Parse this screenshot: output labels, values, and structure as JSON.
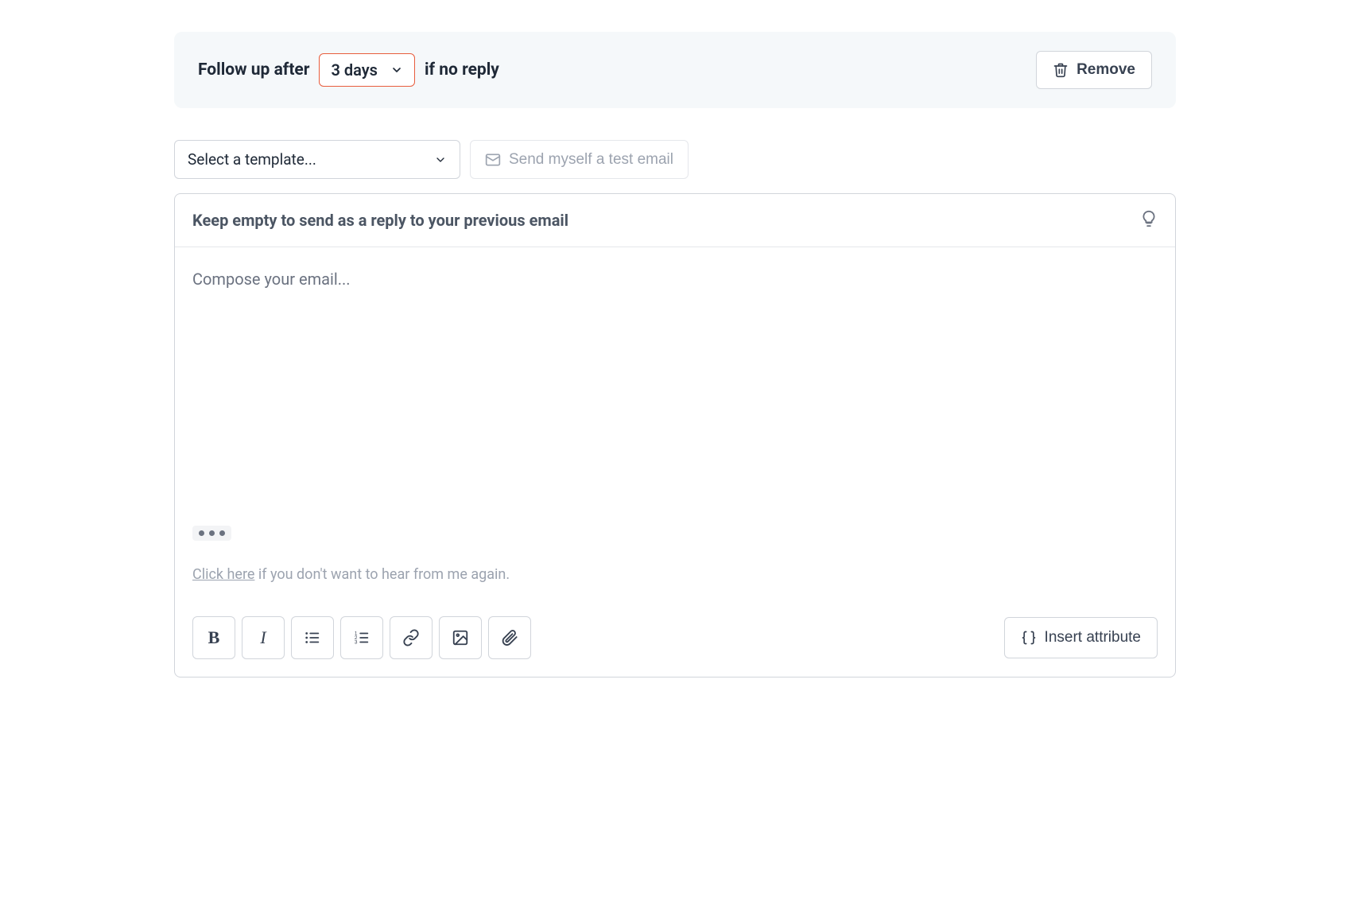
{
  "followup": {
    "prefix": "Follow up after",
    "delay": "3 days",
    "suffix": "if no reply",
    "remove_label": "Remove"
  },
  "controls": {
    "template_placeholder": "Select a template...",
    "test_email_label": "Send myself a test email"
  },
  "editor": {
    "subject_placeholder": "Keep empty to send as a reply to your previous email",
    "body_placeholder": "Compose your email...",
    "unsubscribe_link": "Click here",
    "unsubscribe_rest": " if you don't want to hear from me again."
  },
  "toolbar": {
    "insert_attribute_label": "Insert attribute"
  }
}
